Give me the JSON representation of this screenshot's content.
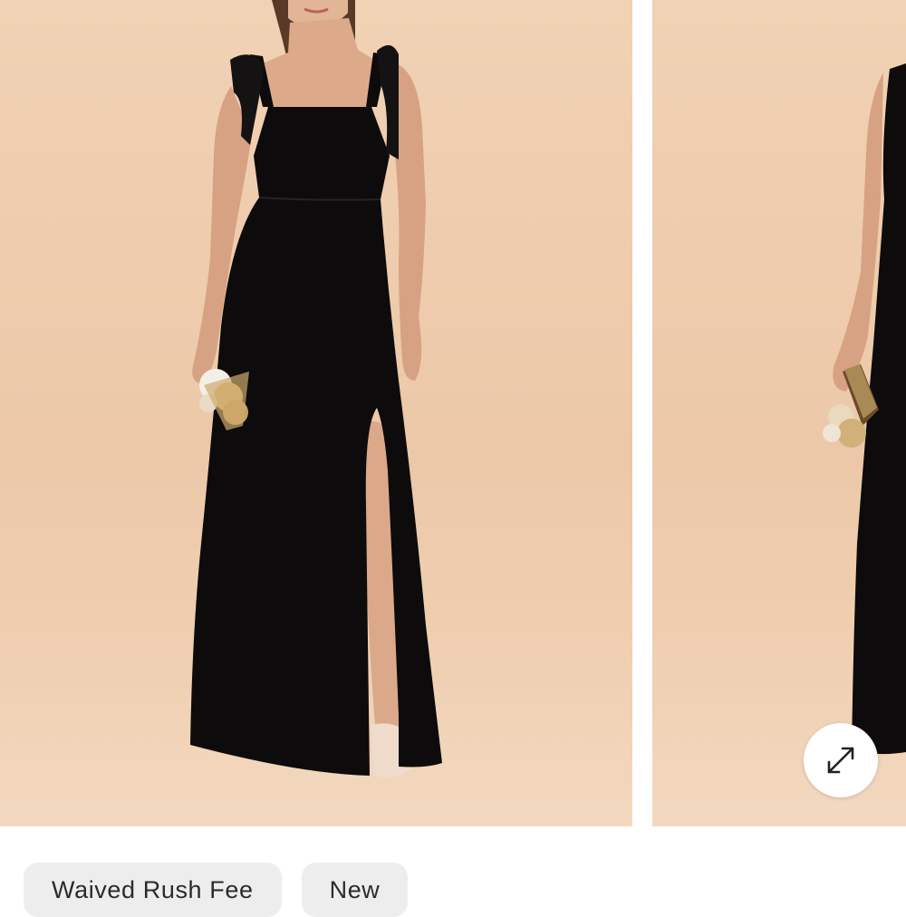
{
  "gallery": {
    "slides": [
      {
        "subject": "model-black-gown-front"
      },
      {
        "subject": "model-black-gown-side"
      }
    ],
    "expand_icon": "expand-arrows-icon"
  },
  "tags": [
    {
      "label": "Waived Rush Fee"
    },
    {
      "label": "New"
    }
  ],
  "colors": {
    "backdrop": "#efceae",
    "dress": "#0d0b0c",
    "tag_background": "#ededed",
    "tag_text": "#2b2b2b"
  }
}
